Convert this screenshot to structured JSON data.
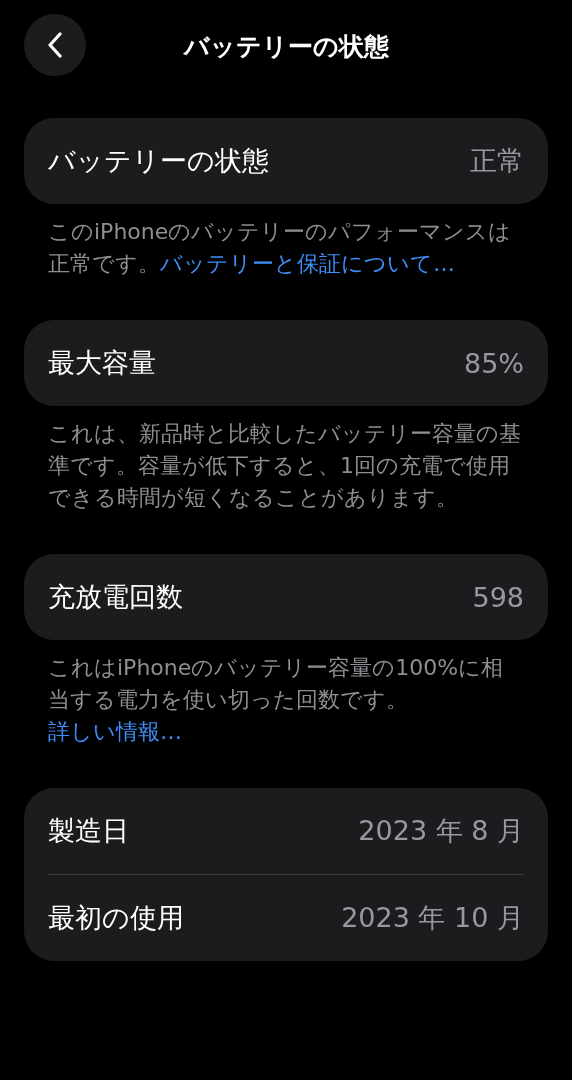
{
  "header": {
    "title": "バッテリーの状態"
  },
  "sections": [
    {
      "rows": [
        {
          "label": "バッテリーの状態",
          "value": "正常"
        }
      ],
      "footer": {
        "text": "このiPhoneのバッテリーのパフォーマンスは正常です。",
        "link": "バッテリーと保証について…"
      }
    },
    {
      "rows": [
        {
          "label": "最大容量",
          "value": "85%"
        }
      ],
      "footer": {
        "text": "これは、新品時と比較したバッテリー容量の基準です。容量が低下すると、1回の充電で使用できる時間が短くなることがあります。"
      }
    },
    {
      "rows": [
        {
          "label": "充放電回数",
          "value": "598"
        }
      ],
      "footer": {
        "text": "これはiPhoneのバッテリー容量の100%に相当する電力を使い切った回数です。",
        "link": "詳しい情報…"
      }
    },
    {
      "rows": [
        {
          "label": "製造日",
          "value": "2023 年 8 月"
        },
        {
          "label": "最初の使用",
          "value": "2023 年 10 月"
        }
      ]
    }
  ]
}
